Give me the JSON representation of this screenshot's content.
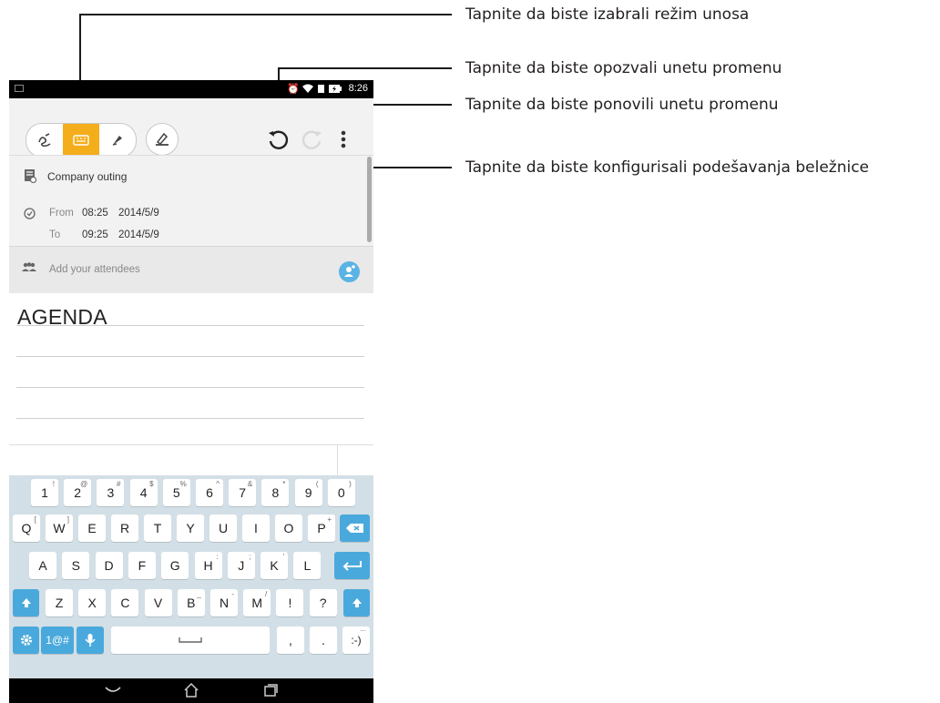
{
  "callouts": {
    "input_mode": "Tapnite da biste izabrali režim unosa",
    "undo": "Tapnite da biste opozvali unetu promenu",
    "redo": "Tapnite da biste ponovili unetu promenu",
    "settings": "Tapnite da biste konfigurisali podešavanja beležnice"
  },
  "status_bar": {
    "time": "8:26",
    "icons": [
      "alarm-icon",
      "wifi-icon",
      "sim-icon",
      "battery-charging-icon"
    ]
  },
  "toolbar": {
    "modes": [
      {
        "icon": "handwriting-icon",
        "active": false
      },
      {
        "icon": "keyboard-icon",
        "active": true
      },
      {
        "icon": "pen-draw-icon",
        "active": false
      }
    ],
    "extra": "highlighter-icon",
    "undo_icon": "undo-icon",
    "redo_icon": "redo-icon",
    "menu_icon": "more-vert-icon"
  },
  "note": {
    "title": "Company outing",
    "from_label": "From",
    "from_time": "08:25",
    "from_date": "2014/5/9",
    "to_label": "To",
    "to_time": "09:25",
    "to_date": "2014/5/9",
    "attendees_placeholder": "Add your attendees",
    "body_text": "AGENDA"
  },
  "keyboard": {
    "number_row": [
      {
        "k": "1",
        "a": "!"
      },
      {
        "k": "2",
        "a": "@"
      },
      {
        "k": "3",
        "a": "#"
      },
      {
        "k": "4",
        "a": "$"
      },
      {
        "k": "5",
        "a": "%"
      },
      {
        "k": "6",
        "a": "^"
      },
      {
        "k": "7",
        "a": "&"
      },
      {
        "k": "8",
        "a": "*"
      },
      {
        "k": "9",
        "a": "("
      },
      {
        "k": "0",
        "a": ")"
      }
    ],
    "row1": [
      {
        "k": "Q",
        "a": "["
      },
      {
        "k": "W",
        "a": "]"
      },
      {
        "k": "E",
        "a": ""
      },
      {
        "k": "R",
        "a": ""
      },
      {
        "k": "T",
        "a": ""
      },
      {
        "k": "Y",
        "a": ""
      },
      {
        "k": "U",
        "a": ""
      },
      {
        "k": "I",
        "a": ""
      },
      {
        "k": "O",
        "a": ""
      },
      {
        "k": "P",
        "a": "+"
      }
    ],
    "row2": [
      {
        "k": "A",
        "a": ""
      },
      {
        "k": "S",
        "a": ""
      },
      {
        "k": "D",
        "a": ""
      },
      {
        "k": "F",
        "a": ""
      },
      {
        "k": "G",
        "a": ""
      },
      {
        "k": "H",
        "a": ":"
      },
      {
        "k": "J",
        "a": ";"
      },
      {
        "k": "K",
        "a": "'"
      },
      {
        "k": "L",
        "a": ""
      }
    ],
    "row3": [
      {
        "k": "Z",
        "a": ""
      },
      {
        "k": "X",
        "a": ""
      },
      {
        "k": "C",
        "a": ""
      },
      {
        "k": "V",
        "a": ""
      },
      {
        "k": "B",
        "a": "_"
      },
      {
        "k": "N",
        "a": "-"
      },
      {
        "k": "M",
        "a": "/"
      },
      {
        "k": "!",
        "a": ""
      },
      {
        "k": "?",
        "a": ""
      }
    ],
    "symbols_label": "1@#",
    "comma": ",",
    "period": ".",
    "smiley": ":-)",
    "smiley_alt": "..."
  },
  "colors": {
    "accent": "#f4ad1b",
    "key_blue": "#4aa9dc",
    "attendee_blue": "#5bb3e3"
  }
}
